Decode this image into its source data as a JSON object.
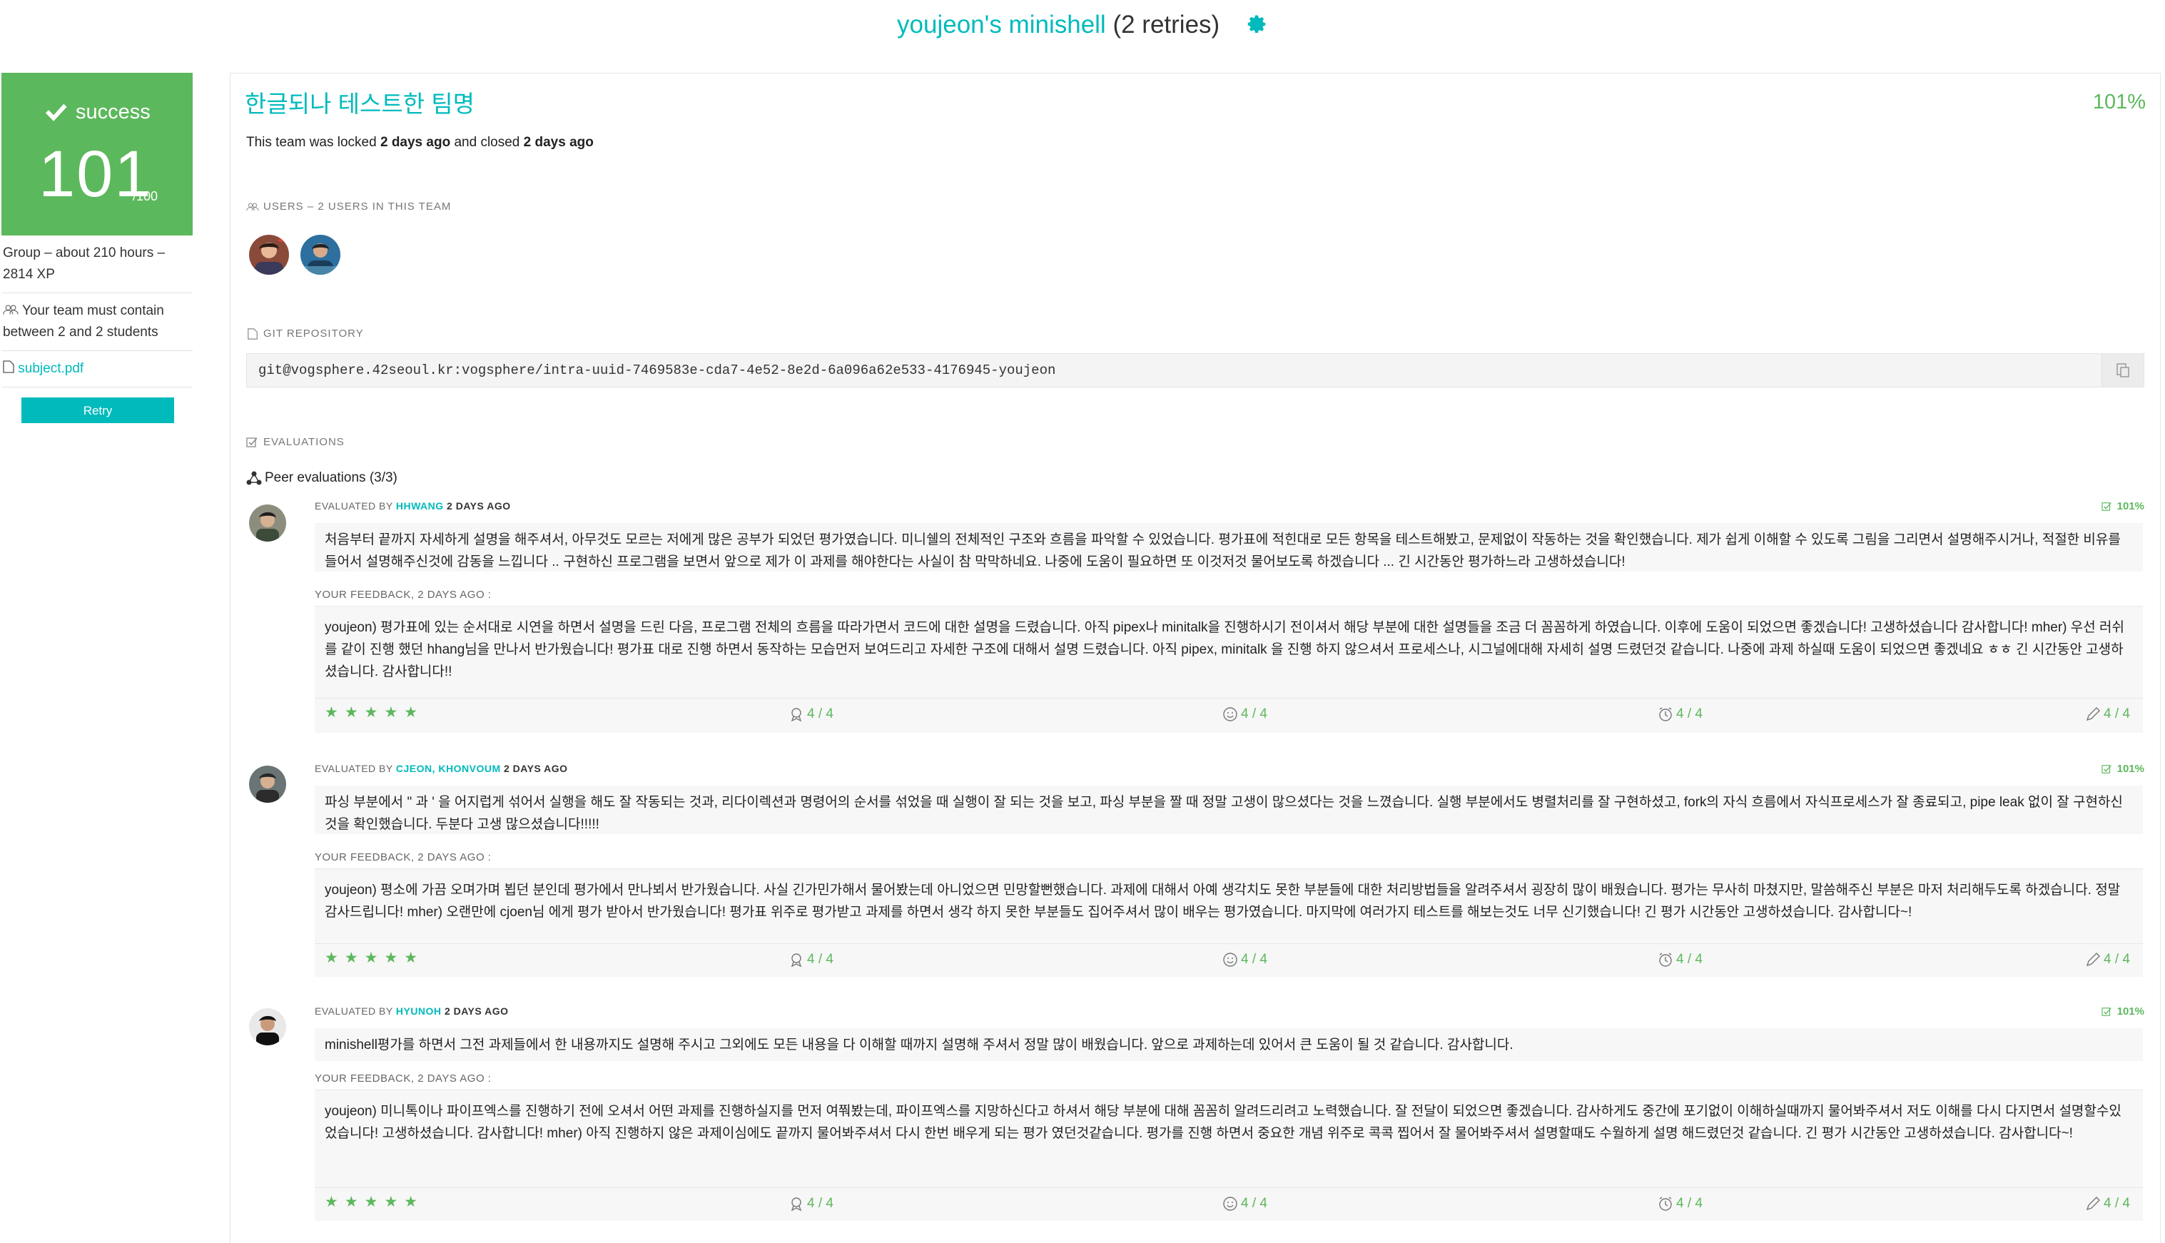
{
  "header": {
    "project_owner": "youjeon's minishell",
    "retries": "(2 retries)"
  },
  "sidebar": {
    "status": "success",
    "score": "101",
    "score_max": "/100",
    "group_info": "Group – about 210 hours – 2814 XP",
    "team_rule": "Your team must contain between 2 and 2 students",
    "subject_link": "subject.pdf",
    "retry_label": "Retry"
  },
  "team": {
    "name": "한글되나 테스트한 팀명",
    "percentage": "101%",
    "locked_prefix": "This team was locked ",
    "locked_when": "2 days ago",
    "locked_middle": " and closed ",
    "closed_when": "2 days ago"
  },
  "users_section": {
    "label": "USERS – 2 USERS IN THIS TEAM",
    "avatars": [
      "youjeon",
      "teammate"
    ]
  },
  "git": {
    "label": "GIT REPOSITORY",
    "url": "git@vogsphere.42seoul.kr:vogsphere/intra-uuid-7469583e-cda7-4e52-8e2d-6a096a62e533-4176945-youjeon"
  },
  "evaluations_section": {
    "label": "EVALUATIONS",
    "peer_title": "Peer evaluations (3/3)"
  },
  "evaluations": [
    {
      "prefix": "EVALUATED BY ",
      "evaluator": "HHWANG",
      "when": "2 DAYS AGO",
      "percentage": "101%",
      "comment": "처음부터 끝까지 자세하게 설명을 해주셔서, 아무것도 모르는 저에게 많은 공부가 되었던 평가였습니다. 미니쉘의 전체적인 구조와 흐름을 파악할 수 있었습니다. 평가표에 적힌대로 모든 항목을 테스트해봤고, 문제없이 작동하는 것을 확인했습니다. 제가 쉽게 이해할 수 있도록 그림을 그리면서 설명해주시거나, 적절한 비유를 들어서 설명해주신것에 감동을 느낍니다 .. 구현하신 프로그램을 보면서 앞으로 제가 이 과제를 해야한다는 사실이 참 막막하네요. 나중에 도움이 필요하면 또 이것저것 물어보도록 하겠습니다 ... 긴 시간동안 평가하느라 고생하셨습니다!",
      "feedback_label": "YOUR FEEDBACK, 2 DAYS AGO :",
      "feedback": "youjeon) 평가표에 있는 순서대로 시연을 하면서 설명을 드린 다음, 프로그램 전체의 흐름을 따라가면서 코드에 대한 설명을 드렸습니다. 아직 pipex나 minitalk을 진행하시기 전이셔서 해당 부분에 대한 설명들을 조금 더 꼼꼼하게 하였습니다. 이후에 도움이 되었으면 좋겠습니다! 고생하셨습니다 감사합니다! mher) 우선 러쉬를 같이 진행 했던 hhang님을 만나서 반가웠습니다! 평가표 대로 진행 하면서 동작하는 모습먼저 보여드리고 자세한 구조에 대해서 설명 드렸습니다. 아직 pipex, minitalk 을 진행 하지 않으셔서 프로세스나, 시그널에대해 자세히 설명 드렸던것 같습니다. 나중에 과제 하실때 도움이 되었으면 좋겠네요 ㅎㅎ 긴 시간동안 고생하셨습니다. 감사합니다!!",
      "stars": "★★★★★",
      "ratings": [
        "4 / 4",
        "4 / 4",
        "4 / 4",
        "4 / 4"
      ]
    },
    {
      "prefix": "EVALUATED BY ",
      "evaluator": "CJEON, KHONVOUM",
      "when": "2 DAYS AGO",
      "percentage": "101%",
      "comment": "파싱 부분에서 \" 과 ' 을 어지럽게 섞어서 실행을 해도 잘 작동되는 것과, 리다이렉션과 명령어의 순서를 섞었을 때 실행이 잘 되는 것을 보고, 파싱 부분을 짤 때 정말 고생이 많으셨다는 것을 느꼈습니다. 실행 부분에서도 병렬처리를 잘 구현하셨고, fork의 자식 흐름에서 자식프로세스가 잘 종료되고, pipe leak 없이 잘 구현하신 것을 확인했습니다. 두분다 고생 많으셨습니다!!!!!",
      "feedback_label": "YOUR FEEDBACK, 2 DAYS AGO :",
      "feedback": "youjeon) 평소에 가끔 오며가며 뵙던 분인데 평가에서 만나뵈서 반가웠습니다. 사실 긴가민가해서 물어봤는데 아니었으면 민망할뻔했습니다. 과제에 대해서 아예 생각치도 못한 부분들에 대한 처리방법들을 알려주셔서 굉장히 많이 배웠습니다. 평가는 무사히 마쳤지만, 말씀해주신 부분은 마저 처리해두도록 하겠습니다. 정말 감사드립니다! mher) 오랜만에 cjoen님 에게 평가 받아서 반가웠습니다! 평가표 위주로 평가받고 과제를 하면서 생각 하지 못한 부분들도 집어주셔서 많이 배우는 평가였습니다. 마지막에 여러가지 테스트를 해보는것도 너무 신기했습니다! 긴 평가 시간동안 고생하셨습니다. 감사합니다~!",
      "stars": "★★★★★",
      "ratings": [
        "4 / 4",
        "4 / 4",
        "4 / 4",
        "4 / 4"
      ]
    },
    {
      "prefix": "EVALUATED BY ",
      "evaluator": "HYUNOH",
      "when": "2 DAYS AGO",
      "percentage": "101%",
      "comment": "minishell평가를 하면서 그전 과제들에서 한 내용까지도 설명해 주시고 그외에도 모든 내용을 다 이해할 때까지 설명해 주셔서 정말 많이 배웠습니다. 앞으로 과제하는데 있어서 큰 도움이 될 것 같습니다. 감사합니다.",
      "feedback_label": "YOUR FEEDBACK, 2 DAYS AGO :",
      "feedback": "youjeon) 미니톡이나 파이프엑스를 진행하기 전에 오셔서 어떤 과제를 진행하실지를 먼저 여쭤봤는데, 파이프엑스를 지망하신다고 하셔서 해당 부분에 대해 꼼꼼히 알려드리려고 노력했습니다. 잘 전달이 되었으면 좋겠습니다. 감사하게도 중간에 포기없이 이해하실때까지 물어봐주셔서 저도 이해를 다시 다지면서 설명할수있었습니다! 고생하셨습니다. 감사합니다! mher) 아직 진행하지 않은 과제이심에도 끝까지 물어봐주셔서 다시 한번 배우게 되는 평가 였던것같습니다. 평가를 진행 하면서 중요한 개념 위주로 콕콕 찝어서 잘 물어봐주셔서 설명할때도 수월하게 설명 해드렸던것 같습니다. 긴 평가 시간동안 고생하셨습니다. 감사합니다~!",
      "stars": "★★★★★",
      "ratings": [
        "4 / 4",
        "4 / 4",
        "4 / 4",
        "4 / 4"
      ]
    }
  ],
  "colors": {
    "teal": "#00babc",
    "success_green": "#5cb85c"
  },
  "icons": [
    "gear-icon",
    "check-icon",
    "users-icon",
    "file-icon",
    "pdf-icon",
    "copy-icon",
    "checkbox-icon",
    "network-icon",
    "badge-icon",
    "thumbs-icon",
    "smile-icon",
    "alarm-icon",
    "pencil-icon"
  ]
}
